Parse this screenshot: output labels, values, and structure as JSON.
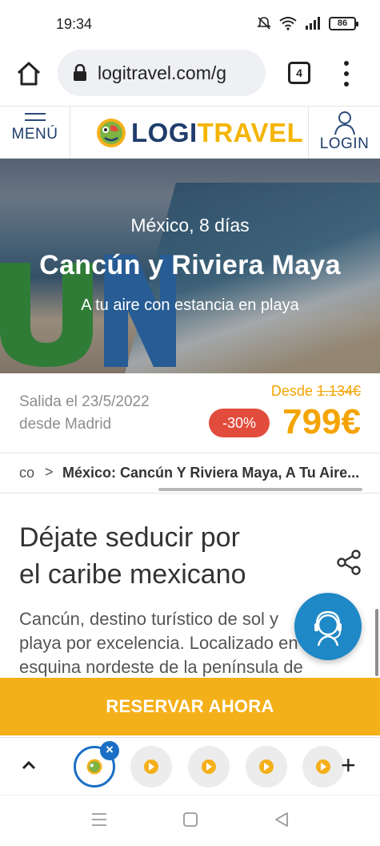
{
  "status_bar": {
    "time": "19:34",
    "battery": "86",
    "icons": [
      "bell-off-icon",
      "wifi-icon",
      "signal-icon",
      "battery-icon"
    ]
  },
  "browser": {
    "url": "logitravel.com/g",
    "tab_count": "4"
  },
  "site_header": {
    "menu_label": "MENÚ",
    "logo_part1": "LOGI",
    "logo_part2": "TRAVEL",
    "login_label": "LOGIN"
  },
  "hero": {
    "subtitle": "México, 8 días",
    "title": "Cancún y Riviera Maya",
    "tagline": "A tu aire con estancia en playa"
  },
  "pricing": {
    "departure_line1": "Salida el 23/5/2022",
    "departure_line2": "desde Madrid",
    "from_label": "Desde",
    "old_price": "1.134€",
    "discount": "-30%",
    "price": "799€"
  },
  "breadcrumb": {
    "previous": "co",
    "separator": ">",
    "current": "México: Cancún Y Riviera Maya, A Tu Aire..."
  },
  "article": {
    "title_line1": "Déjate seducir por",
    "title_line2": "el caribe mexicano",
    "body_line1": "Cancún, destino turístico de sol y",
    "body_line2": "playa por excelencia. Localizado en la",
    "body_line3": "esquina nordeste de la península de"
  },
  "cta": {
    "label": "RESERVAR AHORA"
  },
  "colors": {
    "brand_blue": "#1f3d6b",
    "brand_yellow": "#f4b019",
    "price_orange": "#f4a400",
    "discount_red": "#e24c3c",
    "help_blue": "#1f88c6"
  }
}
